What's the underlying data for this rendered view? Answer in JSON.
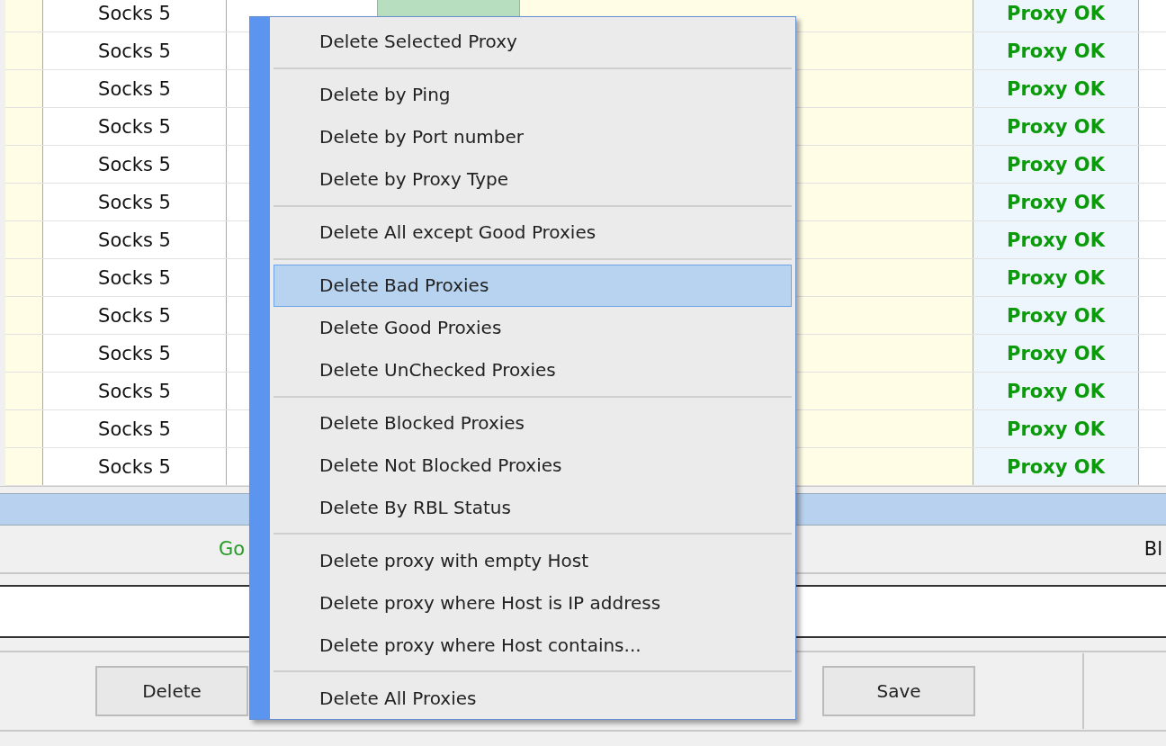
{
  "table": {
    "rows": [
      {
        "type": "Socks 5",
        "ping_ok": true,
        "status": "Proxy OK"
      },
      {
        "type": "Socks 5",
        "status": "Proxy OK"
      },
      {
        "type": "Socks 5",
        "status": "Proxy OK"
      },
      {
        "type": "Socks 5",
        "status": "Proxy OK"
      },
      {
        "type": "Socks 5",
        "status": "Proxy OK"
      },
      {
        "type": "Socks 5",
        "status": "Proxy OK"
      },
      {
        "type": "Socks 5",
        "status": "Proxy OK"
      },
      {
        "type": "Socks 5",
        "status": "Proxy OK"
      },
      {
        "type": "Socks 5",
        "status": "Proxy OK"
      },
      {
        "type": "Socks 5",
        "status": "Proxy OK"
      },
      {
        "type": "Socks 5",
        "status": "Proxy OK"
      },
      {
        "type": "Socks 5",
        "status": "Proxy OK"
      },
      {
        "type": "Socks 5",
        "status": "Proxy OK"
      }
    ]
  },
  "stats": {
    "good_label": "Go",
    "blocked_label": "Bl"
  },
  "buttons": [
    "Delete",
    "Save"
  ],
  "context_menu": {
    "items": [
      {
        "kind": "item",
        "label": "Delete Selected Proxy",
        "selected": false
      },
      {
        "kind": "separator"
      },
      {
        "kind": "item",
        "label": "Delete by Ping",
        "selected": false
      },
      {
        "kind": "item",
        "label": "Delete by Port number",
        "selected": false
      },
      {
        "kind": "item",
        "label": "Delete by Proxy Type",
        "selected": false
      },
      {
        "kind": "separator"
      },
      {
        "kind": "item",
        "label": "Delete All except Good Proxies",
        "selected": false
      },
      {
        "kind": "separator"
      },
      {
        "kind": "item",
        "label": "Delete Bad Proxies",
        "selected": true
      },
      {
        "kind": "item",
        "label": "Delete Good Proxies",
        "selected": false
      },
      {
        "kind": "item",
        "label": "Delete UnChecked Proxies",
        "selected": false
      },
      {
        "kind": "separator"
      },
      {
        "kind": "item",
        "label": "Delete Blocked Proxies",
        "selected": false
      },
      {
        "kind": "item",
        "label": "Delete Not Blocked Proxies",
        "selected": false
      },
      {
        "kind": "item",
        "label": "Delete By RBL Status",
        "selected": false
      },
      {
        "kind": "separator"
      },
      {
        "kind": "item",
        "label": "Delete proxy with empty Host",
        "selected": false
      },
      {
        "kind": "item",
        "label": "Delete proxy where Host is IP address",
        "selected": false
      },
      {
        "kind": "item",
        "label": "Delete proxy where Host contains...",
        "selected": false
      },
      {
        "kind": "separator"
      },
      {
        "kind": "item",
        "label": "Delete All Proxies",
        "selected": false
      }
    ]
  }
}
